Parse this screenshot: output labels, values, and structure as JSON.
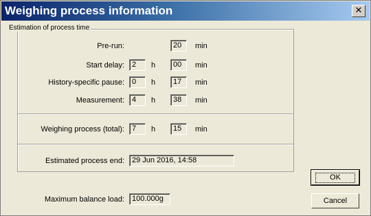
{
  "window": {
    "title": "Weighing process information",
    "close_glyph": "✕"
  },
  "estimation": {
    "group_label": "Estimation of process time",
    "prerun": {
      "label": "Pre-run:",
      "minutes": "20",
      "min_unit": "min"
    },
    "start_delay": {
      "label": "Start delay:",
      "hours": "2",
      "h_unit": "h",
      "minutes": "00",
      "min_unit": "min"
    },
    "history_pause": {
      "label": "History-specific pause:",
      "hours": "0",
      "h_unit": "h",
      "minutes": "17",
      "min_unit": "min"
    },
    "measurement": {
      "label": "Measurement:",
      "hours": "4",
      "h_unit": "h",
      "minutes": "38",
      "min_unit": "min"
    },
    "total": {
      "label": "Weighing process (total):",
      "hours": "7",
      "h_unit": "h",
      "minutes": "15",
      "min_unit": "min"
    },
    "end": {
      "label": "Estimated process end:",
      "value": "29 Jun 2016, 14:58"
    }
  },
  "max_load": {
    "label": "Maximum balance load:",
    "value": "100.000g"
  },
  "buttons": {
    "ok": "OK",
    "cancel": "Cancel"
  }
}
